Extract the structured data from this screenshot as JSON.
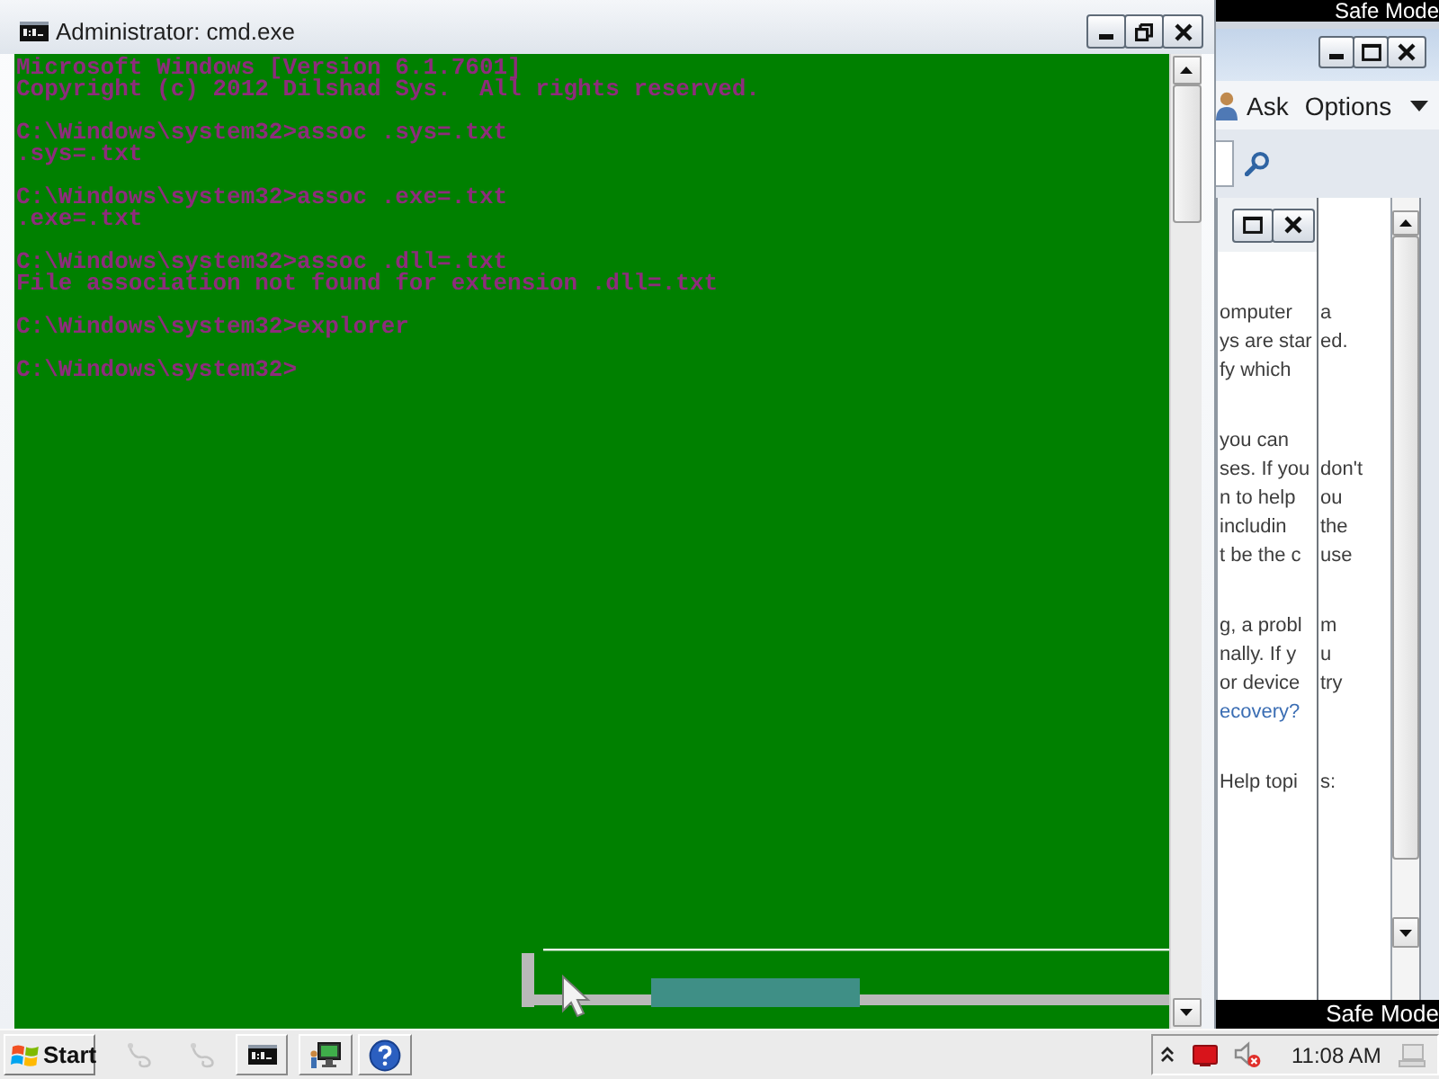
{
  "desktop": {
    "corner_labels": [
      "Safe Mode",
      "Safe Mode"
    ]
  },
  "console_window": {
    "title": "Administrator: cmd.exe",
    "blocks": [
      [
        "Microsoft Windows [Version 6.1.7601]",
        "Copyright (c) 2012 Dilshad Sys.  All rights reserved."
      ],
      [
        "C:\\Windows\\system32>assoc .sys=.txt",
        ".sys=.txt"
      ],
      [
        "C:\\Windows\\system32>assoc .exe=.txt",
        ".exe=.txt"
      ],
      [
        "C:\\Windows\\system32>assoc .dll=.txt",
        "File association not found for extension .dll=.txt"
      ],
      [
        "C:\\Windows\\system32>explorer"
      ],
      [
        "C:\\Windows\\system32>"
      ]
    ]
  },
  "help_window": {
    "toolbar": [
      {
        "kind": "icon_button",
        "label": "Ask"
      },
      {
        "kind": "menu",
        "label": "Options"
      }
    ],
    "paragraphs": [
      [
        {
          "kind": "text",
          "left": "omputer",
          "right": "a"
        },
        {
          "kind": "text",
          "left": "ys are star",
          "right": "ed."
        },
        {
          "kind": "text",
          "left": "fy which"
        }
      ],
      [
        {
          "kind": "text",
          "left": "you can"
        },
        {
          "kind": "text",
          "left": "ses. If you",
          "right": "don't"
        },
        {
          "kind": "text",
          "left": "n to help",
          "right": "ou"
        },
        {
          "kind": "text",
          "left": "includin",
          "right": "the"
        },
        {
          "kind": "text",
          "left": "t be the c",
          "right": "use"
        }
      ],
      [
        {
          "kind": "text",
          "left": "g, a probl",
          "right": "m"
        },
        {
          "kind": "text",
          "left": "nally. If y",
          "right": "u"
        },
        {
          "kind": "text",
          "left": "or device",
          "right": "try"
        },
        {
          "kind": "link",
          "left": "ecovery?"
        }
      ]
    ],
    "footer": {
      "kind": "text",
      "left": "Help topi",
      "right": "s:"
    }
  },
  "taskbar": {
    "start": "Start",
    "clock": "11:08 AM"
  }
}
